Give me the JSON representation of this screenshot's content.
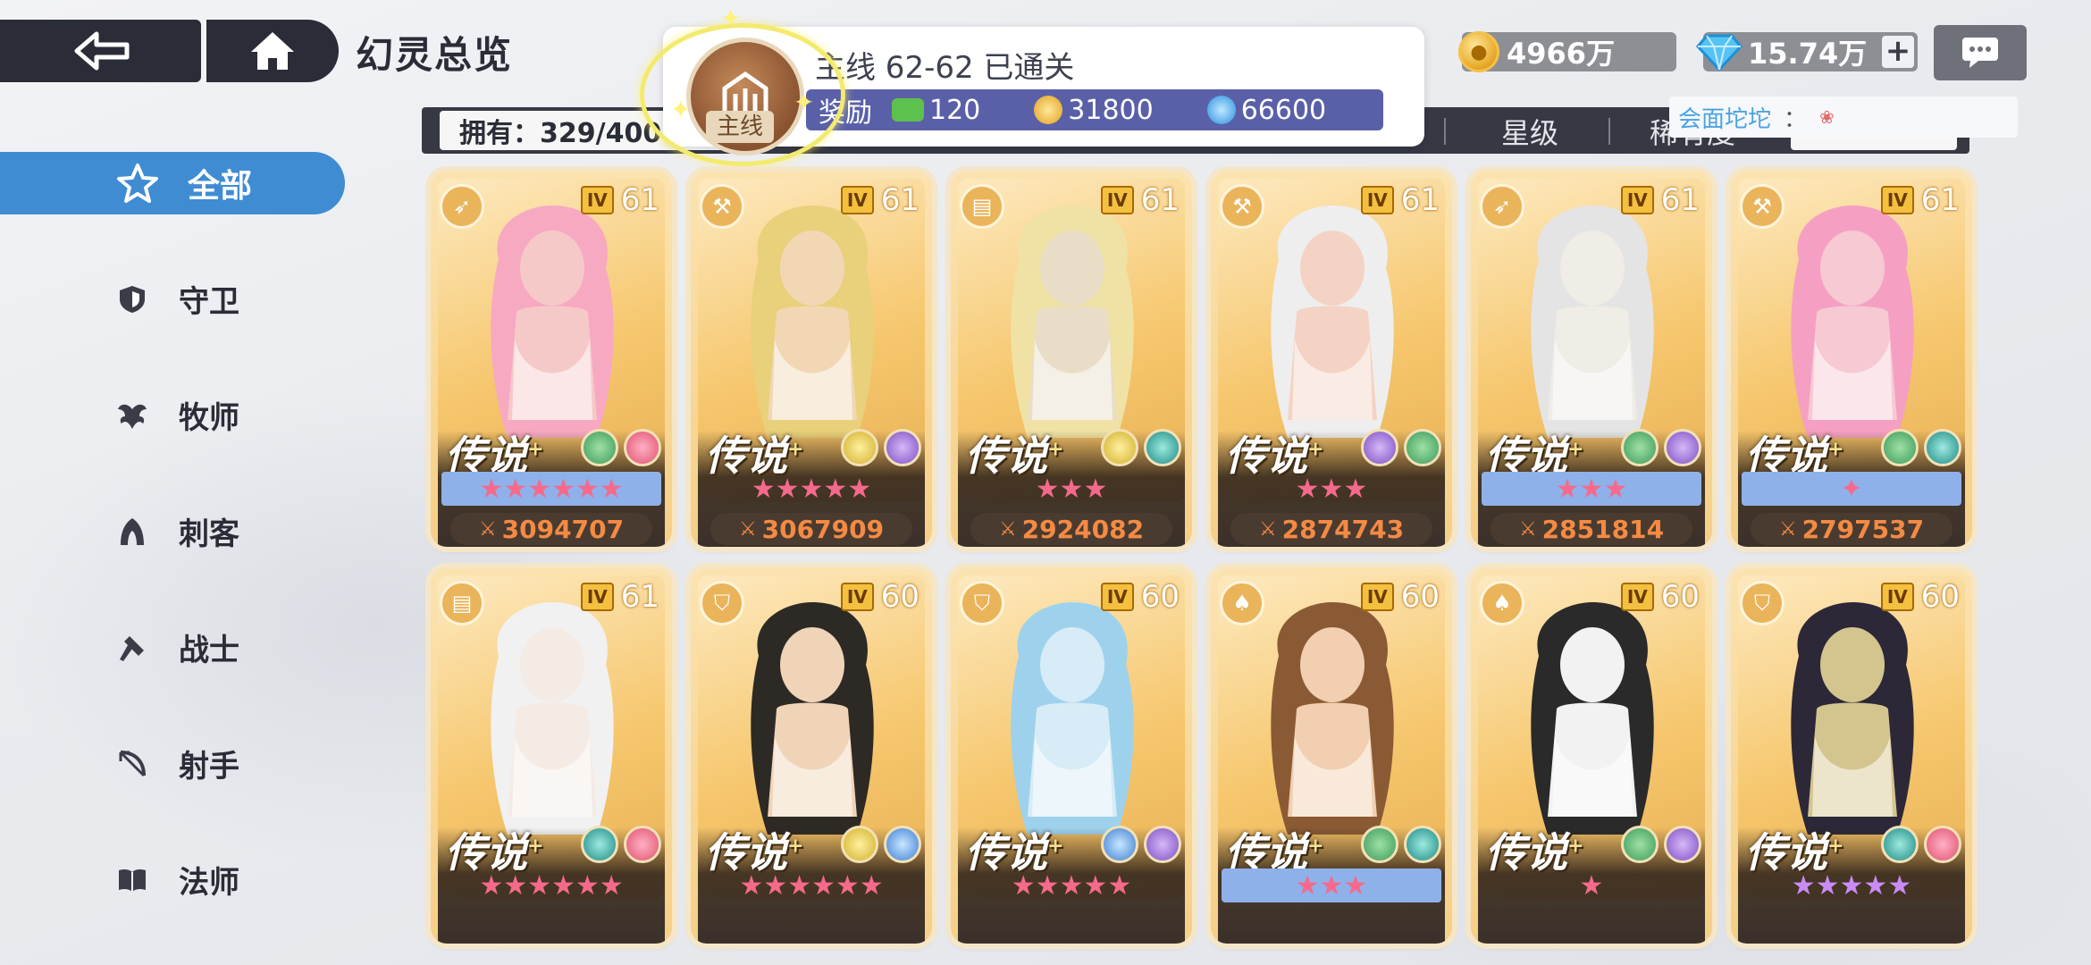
{
  "header": {
    "title": "幻灵总览"
  },
  "currency": {
    "gold": "4966万",
    "gems": "15.74万",
    "plus": "+"
  },
  "tooltip": {
    "who": "会面坨坨",
    "colon": "："
  },
  "mission": {
    "emblem_label": "主线",
    "status": "主线 62-62 已通关",
    "reward_label": "奖励",
    "rewards": [
      "120",
      "31800",
      "66600"
    ]
  },
  "filter": {
    "owned": "拥有：329/400",
    "star_label": "星级",
    "rarity_label": "稀有度"
  },
  "sidebar": [
    {
      "label": "全部",
      "icon": "star-badge-icon"
    },
    {
      "label": "守卫",
      "icon": "shield-icon"
    },
    {
      "label": "牧师",
      "icon": "wing-icon"
    },
    {
      "label": "刺客",
      "icon": "hood-icon"
    },
    {
      "label": "战士",
      "icon": "axe-icon"
    },
    {
      "label": "射手",
      "icon": "bow-icon"
    },
    {
      "label": "法师",
      "icon": "book-icon"
    }
  ],
  "cards": [
    {
      "class": "archer",
      "tier": "IV",
      "level": "61",
      "rarity": "传说",
      "elements": [
        "green",
        "pink"
      ],
      "stars": "★★★★★★",
      "star_style": "blue",
      "power": "3094707"
    },
    {
      "class": "warrior",
      "tier": "IV",
      "level": "61",
      "rarity": "传说",
      "elements": [
        "yellow",
        "purple"
      ],
      "stars": "★★★★★",
      "star_style": "none",
      "power": "3067909"
    },
    {
      "class": "mage",
      "tier": "IV",
      "level": "61",
      "rarity": "传说",
      "elements": [
        "yellow",
        "teal"
      ],
      "stars": "★★★",
      "star_style": "none",
      "power": "2924082"
    },
    {
      "class": "warrior",
      "tier": "IV",
      "level": "61",
      "rarity": "传说",
      "elements": [
        "purple",
        "green"
      ],
      "stars": "★★★",
      "star_style": "none",
      "power": "2874743"
    },
    {
      "class": "archer",
      "tier": "IV",
      "level": "61",
      "rarity": "传说",
      "elements": [
        "green",
        "purple"
      ],
      "stars": "★★★",
      "star_style": "blue",
      "power": "2851814"
    },
    {
      "class": "warrior",
      "tier": "IV",
      "level": "61",
      "rarity": "传说",
      "elements": [
        "green",
        "teal"
      ],
      "stars": "✦",
      "star_style": "blue",
      "power": "2797537"
    },
    {
      "class": "mage",
      "tier": "IV",
      "level": "61",
      "rarity": "传说",
      "elements": [
        "teal",
        "pink"
      ],
      "stars": "★★★★★★",
      "star_style": "none"
    },
    {
      "class": "guardian",
      "tier": "IV",
      "level": "60",
      "rarity": "传说",
      "elements": [
        "yellow",
        "blue"
      ],
      "stars": "★★★★★★",
      "star_style": "none"
    },
    {
      "class": "guardian",
      "tier": "IV",
      "level": "60",
      "rarity": "传说",
      "elements": [
        "blue",
        "purple"
      ],
      "stars": "★★★★★",
      "star_style": "none"
    },
    {
      "class": "assassin",
      "tier": "IV",
      "level": "60",
      "rarity": "传说",
      "elements": [
        "green",
        "teal"
      ],
      "stars": "★★★",
      "star_style": "blue"
    },
    {
      "class": "assassin",
      "tier": "IV",
      "level": "60",
      "rarity": "传说",
      "elements": [
        "green",
        "purple"
      ],
      "stars": "★",
      "star_style": "none"
    },
    {
      "class": "guardian",
      "tier": "IV",
      "level": "60",
      "rarity": "传说",
      "elements": [
        "teal",
        "pink"
      ],
      "stars": "★★★★★",
      "star_style": "purple"
    }
  ],
  "colors": {
    "accent": "#3f8cd3",
    "dark": "#2a2d37",
    "reward_bar": "#5a60a8",
    "power_text": "#f58a43"
  }
}
